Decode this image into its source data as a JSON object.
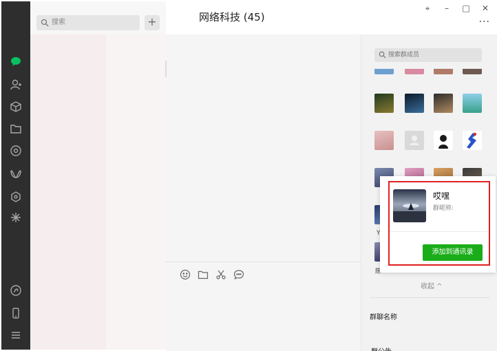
{
  "list_search": {
    "placeholder": "搜索"
  },
  "add_button": "+",
  "chat": {
    "title": "网络科技 (45)"
  },
  "window_controls": {
    "pin": "⌖",
    "minimize": "–",
    "maximize": "□",
    "close": "✕",
    "more": "···"
  },
  "members": {
    "search_placeholder": "搜索群成员",
    "row_labels": [
      "Y",
      "陈"
    ],
    "collapse_label": "收起 ^",
    "group_name_label": "群聊名称",
    "group_notice_label": "群公告"
  },
  "card": {
    "name": "哎嘿",
    "nickname_label": "群昵称:",
    "add_button": "添加到通讯录"
  },
  "accent_color": "#1aad19",
  "highlight_color": "#e02020"
}
